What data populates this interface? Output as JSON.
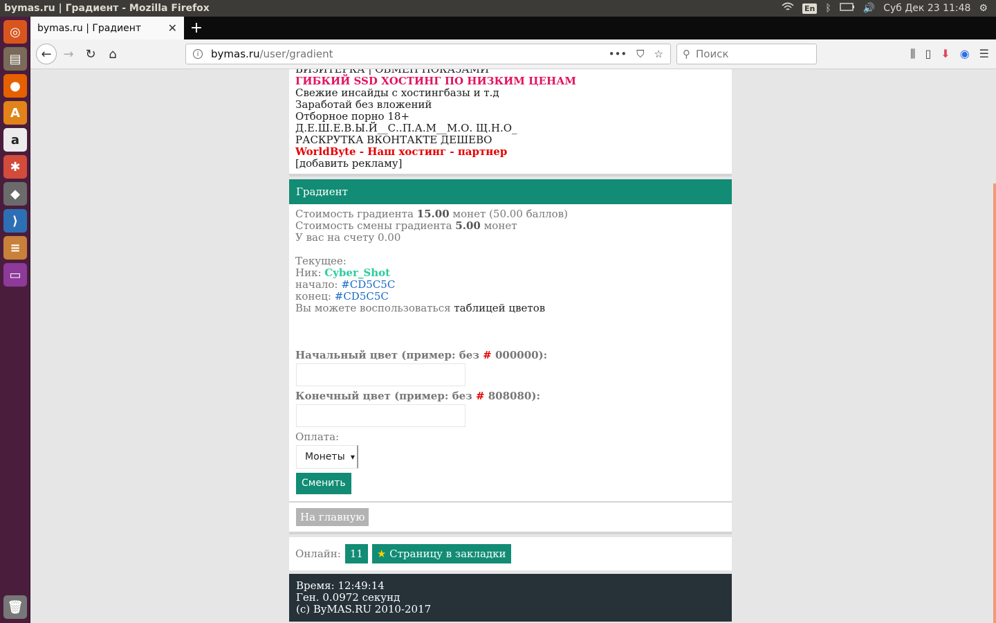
{
  "os": {
    "window_title": "bymas.ru | Градиент - Mozilla Firefox",
    "keyboard": "En",
    "clock": "Суб Дек 23 11:48"
  },
  "launcher": {
    "items": [
      {
        "name": "ubuntu-dash-icon",
        "glyph": "◎",
        "color": "#d9551e"
      },
      {
        "name": "files-icon",
        "glyph": "▤",
        "color": "#7a6a5a"
      },
      {
        "name": "firefox-icon",
        "glyph": "●",
        "color": "#e66000"
      },
      {
        "name": "software-center-icon",
        "glyph": "A",
        "color": "#e2831a"
      },
      {
        "name": "amazon-icon",
        "glyph": "a",
        "color": "#ececec"
      },
      {
        "name": "settings-icon",
        "glyph": "✱",
        "color": "#d24b3b"
      },
      {
        "name": "gimp-icon",
        "glyph": "◆",
        "color": "#6b6b6b"
      },
      {
        "name": "vscode-icon",
        "glyph": "⟩",
        "color": "#2d6fb5"
      },
      {
        "name": "tweaks-icon",
        "glyph": "≡",
        "color": "#c8803a"
      },
      {
        "name": "workspace-icon",
        "glyph": "▭",
        "color": "#8d3a9a"
      }
    ],
    "trash": {
      "name": "trash-icon",
      "glyph": "🗑"
    }
  },
  "browser": {
    "tab_title": "bymas.ru | Градиент",
    "url_host": "bymas.ru",
    "url_path": "/user/gradient",
    "search_placeholder": "Поиск"
  },
  "ads": {
    "line0": "ВИЗИТЕРКА | ОБМЕН ПОКАЗАМИ",
    "hot1": "ГИБКИЙ SSD ХОСТИНГ ПО НИЗКИМ ЦЕНАМ",
    "line2": "Свежие инсайды с хостингбазы и т.д",
    "line3": "Заработай без вложений",
    "line4": "Отборное порно 18+",
    "line5": "Д.Е.Ш.Е.В.Ы.Й__С..П.А.М__М.О. Щ.Н.О_",
    "line6": "РАСКРУТКА ВКОНТАКТЕ ДЕШЕВО",
    "hot2": "WorldByte - Наш хостинг - партнер",
    "add": "[добавить рекламу]"
  },
  "gradient": {
    "header": "Градиент",
    "cost_prefix": "Стоимость градиента ",
    "cost_value": "15.00",
    "cost_suffix": " монет (50.00 баллов)",
    "change_prefix": "Стоимость смены градиента ",
    "change_value": "5.00",
    "change_suffix": " монет",
    "balance": "У вас на счету 0.00",
    "current_label": "Текущее:",
    "nick_label": "Ник: ",
    "nick_value": "Cyber_Shot",
    "start_label": "начало: ",
    "start_value": "#CD5C5C",
    "end_label": "конец: ",
    "end_value": "#CD5C5C",
    "table_prefix": "Вы можете воспользоваться ",
    "table_link": "таблицей цветов",
    "start_field_label_a": "Начальный цвет (пример: без ",
    "start_field_label_b": " 000000):",
    "end_field_label_a": "Конечный цвет (пример: без ",
    "end_field_label_b": " 808080):",
    "hash": "#",
    "payment_label": "Оплата:",
    "payment_selected": "Монеты",
    "submit": "Сменить"
  },
  "home_button": "На главную",
  "online": {
    "label": "Онлайн:",
    "count": "11",
    "bookmark": "Страницу в закладки"
  },
  "footer": {
    "time": "Время: 12:49:14",
    "gen": "Ген. 0.0972 секунд",
    "copy": "(c) ByMAS.RU 2010-2017"
  }
}
